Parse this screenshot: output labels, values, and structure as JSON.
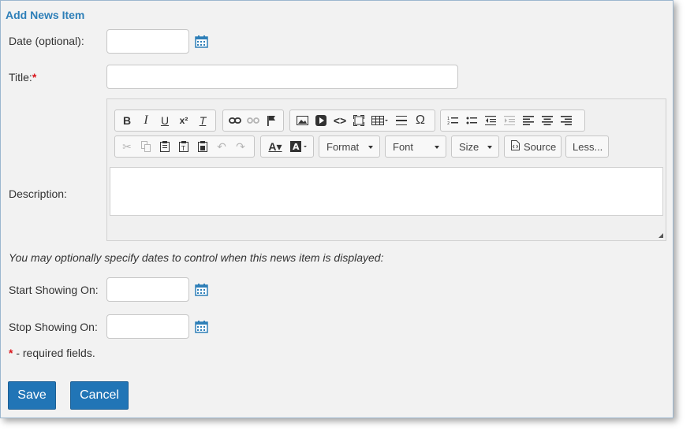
{
  "form": {
    "title": "Add News Item",
    "date_label": "Date (optional):",
    "date_value": "",
    "title_label": "Title:",
    "required_mark": "*",
    "title_value": "",
    "description_label": "Description:",
    "optional_note": "You may optionally specify dates to control when this news item is displayed:",
    "start_label": "Start Showing On:",
    "start_value": "",
    "stop_label": "Stop Showing On:",
    "stop_value": "",
    "required_note": " - required fields."
  },
  "editor": {
    "format_label": "Format",
    "font_label": "Font",
    "size_label": "Size",
    "source_label": "Source",
    "less_label": "Less...",
    "content": ""
  },
  "buttons": {
    "save": "Save",
    "cancel": "Cancel"
  },
  "colors": {
    "accent": "#2e7fb8",
    "button": "#2175b6",
    "required": "#d9161c"
  }
}
